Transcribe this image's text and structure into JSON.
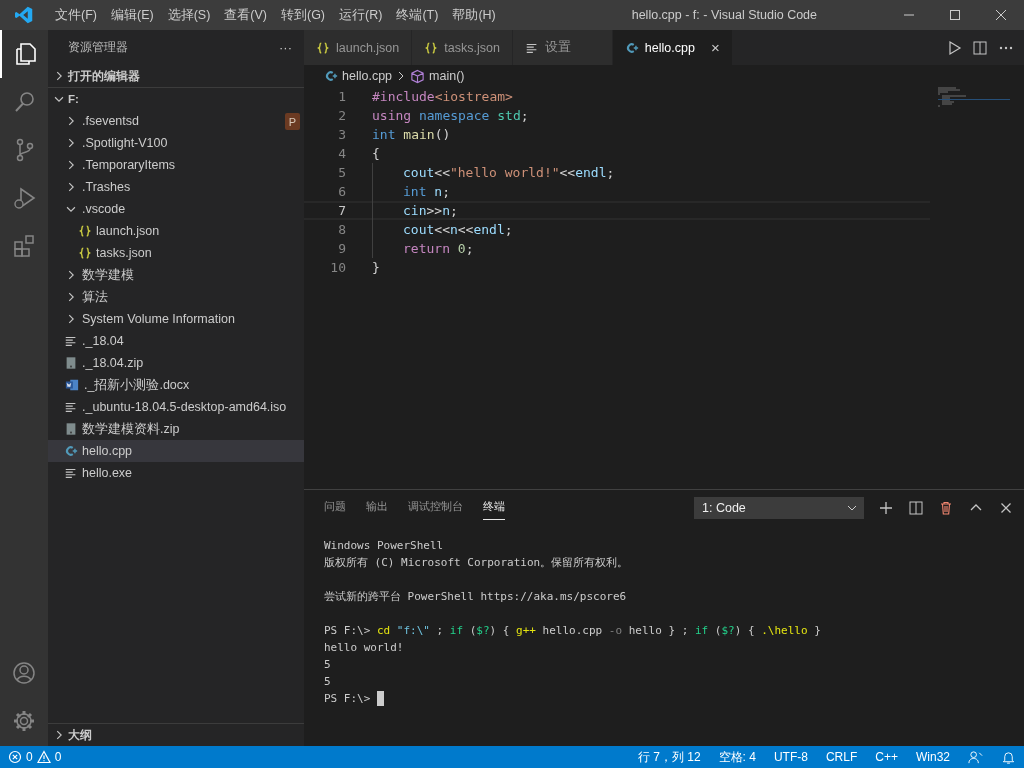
{
  "title_bar": {
    "menu": [
      "文件(F)",
      "编辑(E)",
      "选择(S)",
      "查看(V)",
      "转到(G)",
      "运行(R)",
      "终端(T)",
      "帮助(H)"
    ],
    "title": "hello.cpp - f: - Visual Studio Code"
  },
  "activity_bar": {
    "top": [
      {
        "kind": "files",
        "selected": true
      },
      {
        "kind": "search",
        "selected": false
      },
      {
        "kind": "source-control",
        "selected": false
      },
      {
        "kind": "debug",
        "selected": false
      },
      {
        "kind": "extensions",
        "selected": false
      }
    ],
    "bottom": [
      {
        "kind": "account",
        "selected": false
      },
      {
        "kind": "settings",
        "selected": false
      }
    ]
  },
  "sidebar": {
    "title": "资源管理器",
    "more": "···",
    "open_editors": {
      "label": "打开的编辑器",
      "expanded": false
    },
    "folder": {
      "label": "F:",
      "expanded": true,
      "items": [
        {
          "label": ".fseventsd",
          "kind": "folder",
          "expanded": false,
          "selected": false,
          "badge": "P"
        },
        {
          "label": ".Spotlight-V100",
          "kind": "folder",
          "expanded": false,
          "selected": false
        },
        {
          "label": ".TemporaryItems",
          "kind": "folder",
          "expanded": false,
          "selected": false
        },
        {
          "label": ".Trashes",
          "kind": "folder",
          "expanded": false,
          "selected": false
        },
        {
          "label": ".vscode",
          "kind": "folder",
          "expanded": true,
          "selected": false,
          "children": [
            {
              "label": "launch.json",
              "kind": "json",
              "selected": false
            },
            {
              "label": "tasks.json",
              "kind": "json",
              "selected": false
            }
          ]
        },
        {
          "label": "数学建模",
          "kind": "folder",
          "expanded": false,
          "selected": false
        },
        {
          "label": "算法",
          "kind": "folder",
          "expanded": false,
          "selected": false
        },
        {
          "label": "System Volume Information",
          "kind": "folder",
          "expanded": false,
          "selected": false
        },
        {
          "label": "._18.04",
          "kind": "text",
          "selected": false
        },
        {
          "label": "._18.04.zip",
          "kind": "zip",
          "selected": false
        },
        {
          "label": "._招新小测验.docx",
          "kind": "word",
          "selected": false
        },
        {
          "label": "._ubuntu-18.04.5-desktop-amd64.iso",
          "kind": "text",
          "selected": false
        },
        {
          "label": "数学建模资料.zip",
          "kind": "zip",
          "selected": false
        },
        {
          "label": "hello.cpp",
          "kind": "cpp",
          "selected": true
        },
        {
          "label": "hello.exe",
          "kind": "text",
          "selected": false
        }
      ]
    },
    "outline": {
      "label": "大纲",
      "expanded": false
    }
  },
  "tabs": [
    {
      "label": "launch.json",
      "kind": "json",
      "selected": false
    },
    {
      "label": "tasks.json",
      "kind": "json",
      "selected": false
    },
    {
      "label": "设置",
      "kind": "text",
      "selected": false
    },
    {
      "label": "hello.cpp",
      "kind": "cpp",
      "selected": true,
      "close": "×"
    }
  ],
  "breadcrumb": [
    {
      "label": "hello.cpp",
      "kind": "cpp"
    },
    {
      "label": "main()",
      "kind": "cube"
    }
  ],
  "code": [
    {
      "number": "1",
      "indented": false,
      "current": false,
      "tokens": [
        {
          "kind": "directive",
          "text": "#include"
        },
        {
          "kind": "header",
          "text": "<iostream>"
        }
      ]
    },
    {
      "number": "2",
      "indented": false,
      "current": false,
      "tokens": [
        {
          "kind": "control",
          "text": "using "
        },
        {
          "kind": "storage",
          "text": "namespace "
        },
        {
          "kind": "namespace",
          "text": "std"
        },
        {
          "kind": "plain",
          "text": ";"
        }
      ]
    },
    {
      "number": "3",
      "indented": false,
      "current": false,
      "tokens": [
        {
          "kind": "storage",
          "text": "int "
        },
        {
          "kind": "function",
          "text": "main"
        },
        {
          "kind": "plain",
          "text": "()"
        }
      ]
    },
    {
      "number": "4",
      "indented": false,
      "current": false,
      "tokens": [
        {
          "kind": "plain",
          "text": "{"
        }
      ]
    },
    {
      "number": "5",
      "indented": true,
      "current": false,
      "tokens": [
        {
          "kind": "variable",
          "text": "cout"
        },
        {
          "kind": "plain",
          "text": "<<"
        },
        {
          "kind": "string",
          "text": "\"hello world!\""
        },
        {
          "kind": "plain",
          "text": "<<"
        },
        {
          "kind": "variable",
          "text": "endl"
        },
        {
          "kind": "plain",
          "text": ";"
        }
      ]
    },
    {
      "number": "6",
      "indented": true,
      "current": false,
      "tokens": [
        {
          "kind": "storage",
          "text": "int "
        },
        {
          "kind": "variable",
          "text": "n"
        },
        {
          "kind": "plain",
          "text": ";"
        }
      ]
    },
    {
      "number": "7",
      "indented": true,
      "current": true,
      "tokens": [
        {
          "kind": "variable",
          "text": "cin"
        },
        {
          "kind": "plain",
          "text": ">>"
        },
        {
          "kind": "variable",
          "text": "n"
        },
        {
          "kind": "plain",
          "text": ";"
        }
      ]
    },
    {
      "number": "8",
      "indented": true,
      "current": false,
      "tokens": [
        {
          "kind": "variable",
          "text": "cout"
        },
        {
          "kind": "plain",
          "text": "<<"
        },
        {
          "kind": "variable",
          "text": "n"
        },
        {
          "kind": "plain",
          "text": "<<"
        },
        {
          "kind": "variable",
          "text": "endl"
        },
        {
          "kind": "plain",
          "text": ";"
        }
      ]
    },
    {
      "number": "9",
      "indented": true,
      "current": false,
      "tokens": [
        {
          "kind": "control",
          "text": "return "
        },
        {
          "kind": "number",
          "text": "0"
        },
        {
          "kind": "plain",
          "text": ";"
        }
      ]
    },
    {
      "number": "10",
      "indented": false,
      "current": false,
      "tokens": [
        {
          "kind": "plain",
          "text": "}"
        }
      ]
    }
  ],
  "panel": {
    "tabs": [
      {
        "label": "问题",
        "selected": false
      },
      {
        "label": "输出",
        "selected": false
      },
      {
        "label": "调试控制台",
        "selected": false
      },
      {
        "label": "终端",
        "selected": true
      }
    ],
    "terminal_select": "1: Code",
    "terminal": [
      {
        "kind": "text",
        "tokens": [
          {
            "kind": "plain",
            "text": "Windows PowerShell"
          }
        ]
      },
      {
        "kind": "text",
        "tokens": [
          {
            "kind": "plain",
            "text": "版权所有 (C) Microsoft Corporation。保留所有权利。"
          }
        ]
      },
      {
        "kind": "blank"
      },
      {
        "kind": "text",
        "tokens": [
          {
            "kind": "plain",
            "text": "尝试新的跨平台 PowerShell https://aka.ms/pscore6"
          }
        ]
      },
      {
        "kind": "blank"
      },
      {
        "kind": "text",
        "tokens": [
          {
            "kind": "plain",
            "text": "PS F:\\> "
          },
          {
            "kind": "command",
            "text": "cd"
          },
          {
            "kind": "string",
            "text": " \"f:\\\""
          },
          {
            "kind": "plain",
            "text": " ; "
          },
          {
            "kind": "keyword",
            "text": "if"
          },
          {
            "kind": "plain",
            "text": " ("
          },
          {
            "kind": "keyword",
            "text": "$?"
          },
          {
            "kind": "plain",
            "text": ") { "
          },
          {
            "kind": "command",
            "text": "g++"
          },
          {
            "kind": "plain",
            "text": " hello.cpp "
          },
          {
            "kind": "param",
            "text": "-o"
          },
          {
            "kind": "plain",
            "text": " hello } ; "
          },
          {
            "kind": "keyword",
            "text": "if"
          },
          {
            "kind": "plain",
            "text": " ("
          },
          {
            "kind": "keyword",
            "text": "$?"
          },
          {
            "kind": "plain",
            "text": ") { "
          },
          {
            "kind": "command",
            "text": ".\\hello"
          },
          {
            "kind": "plain",
            "text": " }"
          }
        ]
      },
      {
        "kind": "text",
        "tokens": [
          {
            "kind": "plain",
            "text": "hello world!"
          }
        ]
      },
      {
        "kind": "text",
        "tokens": [
          {
            "kind": "plain",
            "text": "5"
          }
        ]
      },
      {
        "kind": "text",
        "tokens": [
          {
            "kind": "plain",
            "text": "5"
          }
        ]
      },
      {
        "kind": "text",
        "tokens": [
          {
            "kind": "plain",
            "text": "PS F:\\> "
          }
        ],
        "cursor": true
      }
    ]
  },
  "status_bar": {
    "errors": "0",
    "warnings": "0",
    "items": [
      "行 7，列 12",
      "空格: 4",
      "UTF-8",
      "CRLF",
      "C++",
      "Win32"
    ]
  }
}
